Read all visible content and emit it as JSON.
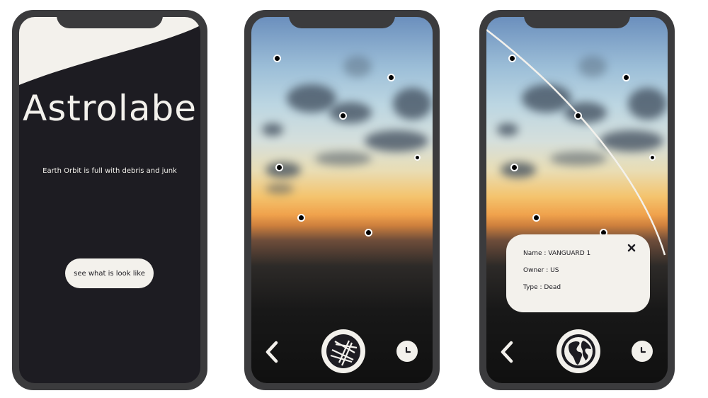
{
  "intro_screen": {
    "title": "Astrolabe",
    "tagline": "Earth Orbit is full with  debris and junk",
    "cta_label": "see what is look like"
  },
  "detail_card": {
    "name_line": "Name : VANGUARD 1",
    "owner_line": "Owner : US",
    "type_line": "Type : Dead"
  },
  "colors": {
    "dark": "#1d1c22",
    "cream": "#f3f1ec",
    "phone_frame": "#3b3b3d"
  },
  "icons": {
    "back": "chevron-left-icon",
    "shutter": "camera-aperture-icon",
    "globe": "globe-icon",
    "history": "clock-icon",
    "close": "close-icon"
  }
}
